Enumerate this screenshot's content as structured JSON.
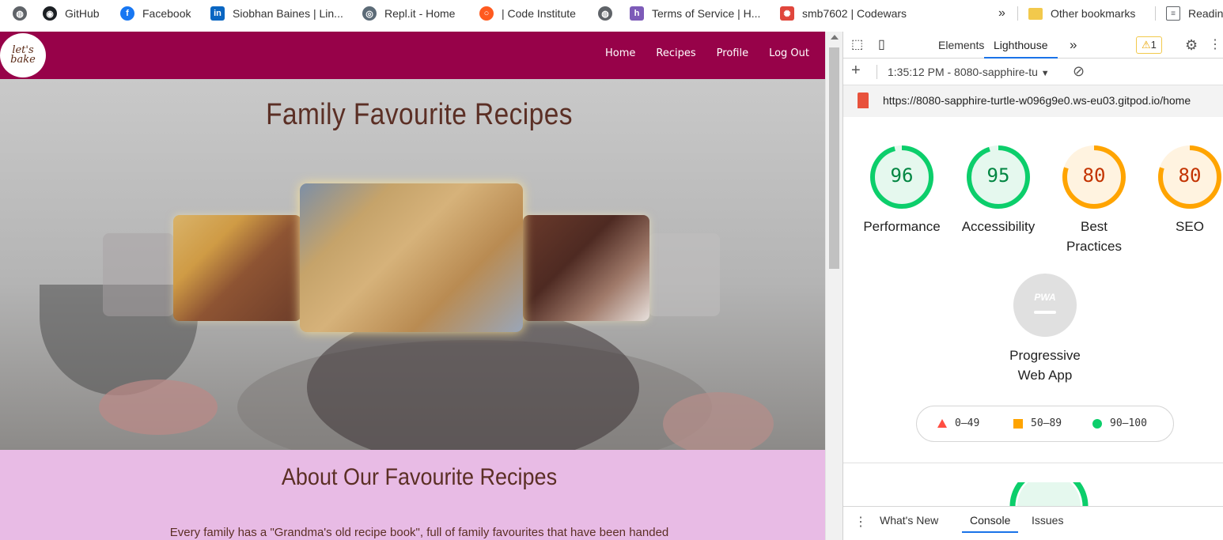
{
  "bookmarks": {
    "items": [
      {
        "label": "",
        "icon": "globe-icon"
      },
      {
        "label": "GitHub",
        "icon": "github-icon"
      },
      {
        "label": "Facebook",
        "icon": "facebook-icon"
      },
      {
        "label": "Siobhan Baines | Lin...",
        "icon": "linkedin-icon"
      },
      {
        "label": "Repl.it - Home",
        "icon": "replit-icon"
      },
      {
        "label": "| Code Institute",
        "icon": "code-institute-icon"
      },
      {
        "label": "",
        "icon": "globe-icon"
      },
      {
        "label": "Terms of Service | H...",
        "icon": "heroku-icon"
      },
      {
        "label": "smb7602 | Codewars",
        "icon": "codewars-icon"
      }
    ],
    "overflow": "»",
    "other": "Other bookmarks",
    "reading": "Readin"
  },
  "site": {
    "logo": "let's bake",
    "nav": {
      "home": "Home",
      "recipes": "Recipes",
      "profile": "Profile",
      "logout": "Log Out"
    },
    "hero_title": "Family Favourite Recipes",
    "about_title": "About Our Favourite Recipes",
    "about_text": "Every family has a \"Grandma's old recipe book\", full of family favourites that have been handed",
    "colors": {
      "navbar": "#970249",
      "about_bg": "#e8bbe5",
      "title_text": "#5b2f25"
    }
  },
  "devtools": {
    "tabs": {
      "elements": "Elements",
      "lighthouse": "Lighthouse",
      "more": "»"
    },
    "warnings": "1",
    "report_time": "1:35:12 PM - 8080-sapphire-tu",
    "url": "https://8080-sapphire-turtle-w096g9e0.ws-eu03.gitpod.io/home",
    "scores": [
      {
        "value": "96",
        "label": "Performance",
        "color": "#0cce6b",
        "fill": 0.96
      },
      {
        "value": "95",
        "label": "Accessibility",
        "color": "#0cce6b",
        "fill": 0.95
      },
      {
        "value": "80",
        "label": "Best Practices",
        "color": "#ffa400",
        "fill": 0.8
      },
      {
        "value": "80",
        "label": "SEO",
        "color": "#ffa400",
        "fill": 0.8
      }
    ],
    "pwa": {
      "badge": "PWA",
      "label_line1": "Progressive",
      "label_line2": "Web App"
    },
    "legend": [
      {
        "range": "0–49",
        "color": "#ff4e42"
      },
      {
        "range": "50–89",
        "color": "#ffa400"
      },
      {
        "range": "90–100",
        "color": "#0cce6b"
      }
    ],
    "drawer": {
      "whats_new": "What's New",
      "console": "Console",
      "issues": "Issues"
    }
  }
}
